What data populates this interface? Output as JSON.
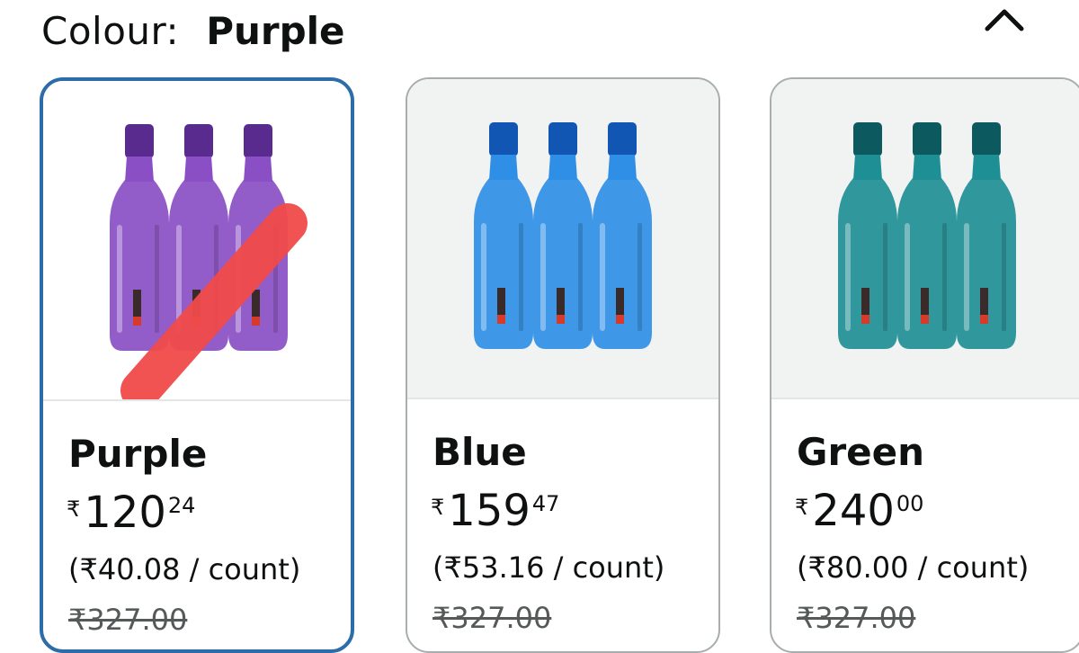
{
  "header": {
    "label": "Colour:",
    "selected_value": "Purple",
    "collapse_icon": "chevron-up-icon"
  },
  "options": [
    {
      "name": "Purple",
      "currency": "₹",
      "price_whole": "120",
      "price_fraction": "24",
      "unit_price": "(₹40.08 / count)",
      "mrp": "₹327.00",
      "bottle_color": "#8a4fc4",
      "bottle_dark": "#5a2b8f",
      "selected": true
    },
    {
      "name": "Blue",
      "currency": "₹",
      "price_whole": "159",
      "price_fraction": "47",
      "unit_price": "(₹53.16 / count)",
      "mrp": "₹327.00",
      "bottle_color": "#2f8fe6",
      "bottle_dark": "#1256b3",
      "selected": false
    },
    {
      "name": "Green",
      "currency": "₹",
      "price_whole": "240",
      "price_fraction": "00",
      "unit_price": "(₹80.00 / count)",
      "mrp": "₹327.00",
      "bottle_color": "#1f8f96",
      "bottle_dark": "#0d5960",
      "selected": false
    }
  ],
  "colors": {
    "selected_border": "#2c6ca8",
    "card_border": "#a8adad",
    "mark_red": "#f04a4a"
  }
}
